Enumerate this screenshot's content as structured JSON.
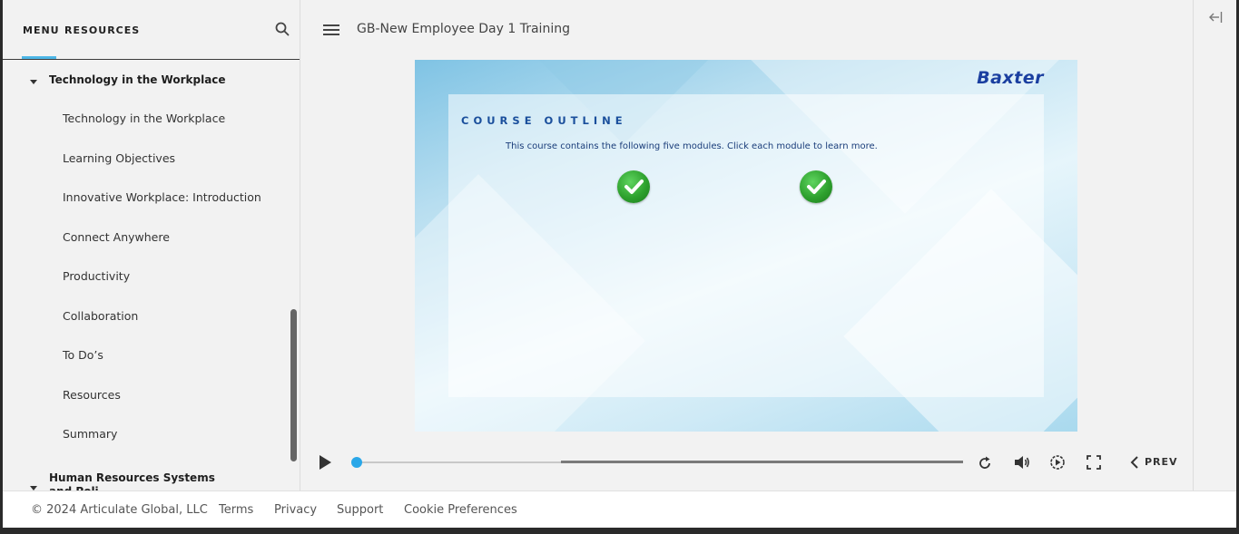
{
  "sidebar": {
    "tabs": [
      "MENU",
      "RESOURCES"
    ],
    "section_title": "Technology in the Workplace",
    "items": [
      "Technology in the Workplace",
      "Learning Objectives",
      "Innovative Workplace: Introduction",
      "Connect Anywhere",
      "Productivity",
      "Collaboration",
      "To Do’s",
      "Resources",
      "Summary"
    ],
    "next_section_title": "Human Resources Systems and Poli..."
  },
  "header": {
    "course_title": "GB-New Employee Day 1 Training"
  },
  "slide": {
    "logo": "Baxter",
    "title": "COURSE OUTLINE",
    "description": "This course contains the following five modules. Click each module to learn more."
  },
  "player": {
    "progress": 0.0,
    "prev_label": "PREV"
  },
  "footer": {
    "copyright": "© 2024 Articulate Global, LLC",
    "links": [
      "Terms",
      "Privacy",
      "Support",
      "Cookie Preferences"
    ]
  },
  "colors": {
    "accent": "#4db6e6",
    "knob": "#2aa7e8",
    "logo": "#1b3fa0"
  },
  "icons": [
    "search-icon",
    "hamburger-icon",
    "checkmark-icon",
    "play-icon",
    "replay-icon",
    "volume-icon",
    "speed-icon",
    "fullscreen-icon",
    "chevron-left-icon",
    "collapse-sidebar-icon"
  ]
}
